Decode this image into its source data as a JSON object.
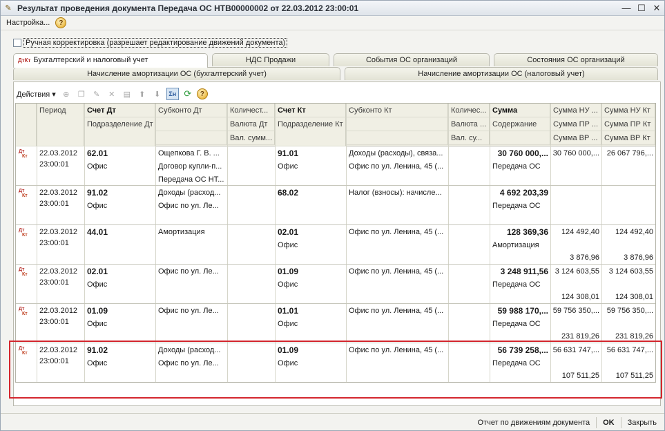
{
  "window": {
    "title": "Результат проведения документа Передача ОС НТВ00000002 от 22.03.2012 23:00:01"
  },
  "menu": {
    "settings": "Настройка...",
    "help": "?"
  },
  "manual_correction": {
    "label": "Ручная корректировка (разрешает редактирование движений документа)",
    "checked": false
  },
  "tabs_row1": [
    {
      "label": "Бухгалтерский и налоговый учет",
      "active": true
    },
    {
      "label": "НДС Продажи"
    },
    {
      "label": "События ОС организаций"
    },
    {
      "label": "Состояния ОС организаций"
    }
  ],
  "tabs_row2": [
    {
      "label": "Начисление амортизации ОС (бухгалтерский учет)"
    },
    {
      "label": "Начисление амортизации ОС (налоговый учет)"
    }
  ],
  "toolbar": {
    "actions": "Действия",
    "sum_icon": "Σн",
    "help": "?"
  },
  "headers": {
    "period": "Период",
    "debit": "Счет Дт",
    "debit_div": "Подразделение Дт",
    "subconto_dt": "Субконто Дт",
    "qty_dt": "Количест...",
    "cur_dt": "Валюта Дт",
    "cur_sum_dt": "Вал. сумм...",
    "credit": "Счет Кт",
    "credit_div": "Подразделение Кт",
    "subconto_kt": "Субконто Кт",
    "qty_kt": "Количес...",
    "cur_kt": "Валюта ...",
    "cur_sum_kt": "Вал. су...",
    "sum": "Сумма",
    "content": "Содержание",
    "nu_dt": "Сумма НУ ...",
    "pr_dt": "Сумма ПР ...",
    "vr_dt": "Сумма ВР ...",
    "nu_kt": "Сумма НУ Кт",
    "pr_kt": "Сумма ПР Кт",
    "vr_kt": "Сумма ВР Кт"
  },
  "rows": [
    {
      "date": "22.03.2012",
      "time": "23:00:01",
      "debit": "62.01",
      "div_dt": "Офис",
      "sub_dt": [
        "Ощепкова Г. В.  ...",
        "Договор купли-п...",
        "Передача ОС НТ..."
      ],
      "credit": "91.01",
      "div_kt": "Офис",
      "sub_kt": [
        "Доходы (расходы), связа...",
        "Офис  по ул. Ленина, 45 (..."
      ],
      "sum": "30 760 000,...",
      "content": "Передача ОС",
      "nu_dt": "30 760 000,...",
      "vr_dt": "",
      "nu_kt": "26 067 796,...",
      "vr_kt": ""
    },
    {
      "date": "22.03.2012",
      "time": "23:00:01",
      "debit": "91.02",
      "div_dt": "Офис",
      "sub_dt": [
        "Доходы (расход...",
        "Офис  по ул. Ле..."
      ],
      "credit": "68.02",
      "div_kt": "",
      "sub_kt": [
        "Налог (взносы): начисле..."
      ],
      "sum": "4 692 203,39",
      "content": "Передача ОС",
      "nu_dt": "",
      "vr_dt": "",
      "nu_kt": "",
      "vr_kt": ""
    },
    {
      "date": "22.03.2012",
      "time": "23:00:01",
      "debit": "44.01",
      "div_dt": "",
      "sub_dt": [
        "Амортизация"
      ],
      "credit": "02.01",
      "div_kt": "Офис",
      "sub_kt": [
        "Офис  по ул. Ленина, 45 (..."
      ],
      "sum": "128 369,36",
      "content": "Амортизация",
      "nu_dt": "124 492,40",
      "vr_dt": "3 876,96",
      "nu_kt": "124 492,40",
      "vr_kt": "3 876,96"
    },
    {
      "date": "22.03.2012",
      "time": "23:00:01",
      "debit": "02.01",
      "div_dt": "Офис",
      "sub_dt": [
        "Офис  по ул. Ле..."
      ],
      "credit": "01.09",
      "div_kt": "Офис",
      "sub_kt": [
        "Офис  по ул. Ленина, 45 (..."
      ],
      "sum": "3 248 911,56",
      "content": "Передача ОС",
      "nu_dt": "3 124 603,55",
      "vr_dt": "124 308,01",
      "nu_kt": "3 124 603,55",
      "vr_kt": "124 308,01"
    },
    {
      "date": "22.03.2012",
      "time": "23:00:01",
      "debit": "01.09",
      "div_dt": "Офис",
      "sub_dt": [
        "Офис  по ул. Ле..."
      ],
      "credit": "01.01",
      "div_kt": "Офис",
      "sub_kt": [
        "Офис  по ул. Ленина, 45 (..."
      ],
      "sum": "59 988 170,...",
      "content": "Передача ОС",
      "nu_dt": "59 756 350,...",
      "vr_dt": "231 819,26",
      "nu_kt": "59 756 350,...",
      "vr_kt": "231 819,26"
    },
    {
      "date": "22.03.2012",
      "time": "23:00:01",
      "debit": "91.02",
      "div_dt": "Офис",
      "sub_dt": [
        "Доходы (расход...",
        "Офис  по ул. Ле..."
      ],
      "credit": "01.09",
      "div_kt": "Офис",
      "sub_kt": [
        "Офис  по ул. Ленина, 45 (..."
      ],
      "sum": "56 739 258,...",
      "content": "Передача ОС",
      "nu_dt": "56 631 747,...",
      "vr_dt": "107 511,25",
      "nu_kt": "56 631 747,...",
      "vr_kt": "107 511,25"
    }
  ],
  "row_icon": {
    "top": "Дт",
    "bottom": "Кт"
  },
  "footer": {
    "report": "Отчет по движениям документа",
    "ok": "OK",
    "close": "Закрыть"
  },
  "colors": {
    "highlight": "#d4262e",
    "header_bg": "#f0efe4"
  }
}
